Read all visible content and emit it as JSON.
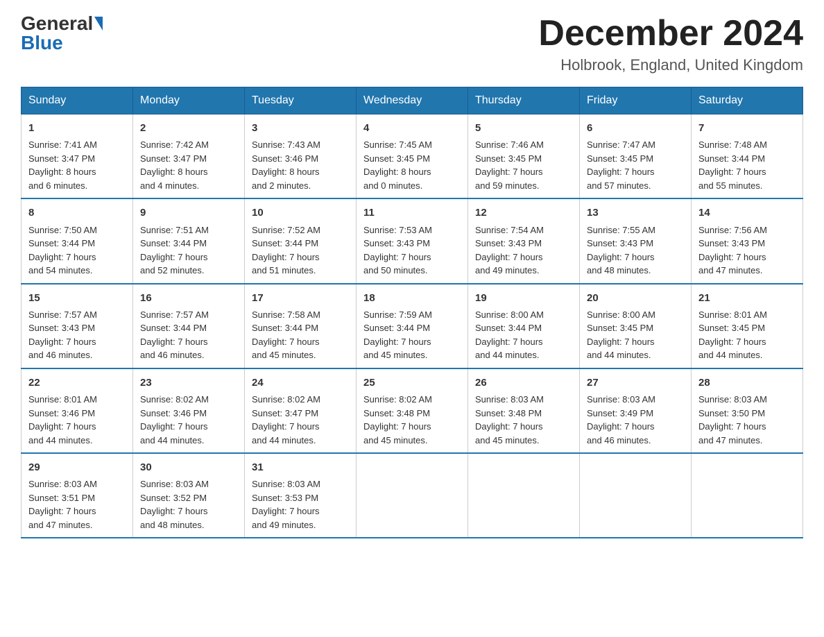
{
  "header": {
    "logo_general": "General",
    "logo_blue": "Blue",
    "month_title": "December 2024",
    "location": "Holbrook, England, United Kingdom"
  },
  "days_of_week": [
    "Sunday",
    "Monday",
    "Tuesday",
    "Wednesday",
    "Thursday",
    "Friday",
    "Saturday"
  ],
  "weeks": [
    [
      {
        "day": "1",
        "sunrise": "7:41 AM",
        "sunset": "3:47 PM",
        "daylight": "8 hours and 6 minutes."
      },
      {
        "day": "2",
        "sunrise": "7:42 AM",
        "sunset": "3:47 PM",
        "daylight": "8 hours and 4 minutes."
      },
      {
        "day": "3",
        "sunrise": "7:43 AM",
        "sunset": "3:46 PM",
        "daylight": "8 hours and 2 minutes."
      },
      {
        "day": "4",
        "sunrise": "7:45 AM",
        "sunset": "3:45 PM",
        "daylight": "8 hours and 0 minutes."
      },
      {
        "day": "5",
        "sunrise": "7:46 AM",
        "sunset": "3:45 PM",
        "daylight": "7 hours and 59 minutes."
      },
      {
        "day": "6",
        "sunrise": "7:47 AM",
        "sunset": "3:45 PM",
        "daylight": "7 hours and 57 minutes."
      },
      {
        "day": "7",
        "sunrise": "7:48 AM",
        "sunset": "3:44 PM",
        "daylight": "7 hours and 55 minutes."
      }
    ],
    [
      {
        "day": "8",
        "sunrise": "7:50 AM",
        "sunset": "3:44 PM",
        "daylight": "7 hours and 54 minutes."
      },
      {
        "day": "9",
        "sunrise": "7:51 AM",
        "sunset": "3:44 PM",
        "daylight": "7 hours and 52 minutes."
      },
      {
        "day": "10",
        "sunrise": "7:52 AM",
        "sunset": "3:44 PM",
        "daylight": "7 hours and 51 minutes."
      },
      {
        "day": "11",
        "sunrise": "7:53 AM",
        "sunset": "3:43 PM",
        "daylight": "7 hours and 50 minutes."
      },
      {
        "day": "12",
        "sunrise": "7:54 AM",
        "sunset": "3:43 PM",
        "daylight": "7 hours and 49 minutes."
      },
      {
        "day": "13",
        "sunrise": "7:55 AM",
        "sunset": "3:43 PM",
        "daylight": "7 hours and 48 minutes."
      },
      {
        "day": "14",
        "sunrise": "7:56 AM",
        "sunset": "3:43 PM",
        "daylight": "7 hours and 47 minutes."
      }
    ],
    [
      {
        "day": "15",
        "sunrise": "7:57 AM",
        "sunset": "3:43 PM",
        "daylight": "7 hours and 46 minutes."
      },
      {
        "day": "16",
        "sunrise": "7:57 AM",
        "sunset": "3:44 PM",
        "daylight": "7 hours and 46 minutes."
      },
      {
        "day": "17",
        "sunrise": "7:58 AM",
        "sunset": "3:44 PM",
        "daylight": "7 hours and 45 minutes."
      },
      {
        "day": "18",
        "sunrise": "7:59 AM",
        "sunset": "3:44 PM",
        "daylight": "7 hours and 45 minutes."
      },
      {
        "day": "19",
        "sunrise": "8:00 AM",
        "sunset": "3:44 PM",
        "daylight": "7 hours and 44 minutes."
      },
      {
        "day": "20",
        "sunrise": "8:00 AM",
        "sunset": "3:45 PM",
        "daylight": "7 hours and 44 minutes."
      },
      {
        "day": "21",
        "sunrise": "8:01 AM",
        "sunset": "3:45 PM",
        "daylight": "7 hours and 44 minutes."
      }
    ],
    [
      {
        "day": "22",
        "sunrise": "8:01 AM",
        "sunset": "3:46 PM",
        "daylight": "7 hours and 44 minutes."
      },
      {
        "day": "23",
        "sunrise": "8:02 AM",
        "sunset": "3:46 PM",
        "daylight": "7 hours and 44 minutes."
      },
      {
        "day": "24",
        "sunrise": "8:02 AM",
        "sunset": "3:47 PM",
        "daylight": "7 hours and 44 minutes."
      },
      {
        "day": "25",
        "sunrise": "8:02 AM",
        "sunset": "3:48 PM",
        "daylight": "7 hours and 45 minutes."
      },
      {
        "day": "26",
        "sunrise": "8:03 AM",
        "sunset": "3:48 PM",
        "daylight": "7 hours and 45 minutes."
      },
      {
        "day": "27",
        "sunrise": "8:03 AM",
        "sunset": "3:49 PM",
        "daylight": "7 hours and 46 minutes."
      },
      {
        "day": "28",
        "sunrise": "8:03 AM",
        "sunset": "3:50 PM",
        "daylight": "7 hours and 47 minutes."
      }
    ],
    [
      {
        "day": "29",
        "sunrise": "8:03 AM",
        "sunset": "3:51 PM",
        "daylight": "7 hours and 47 minutes."
      },
      {
        "day": "30",
        "sunrise": "8:03 AM",
        "sunset": "3:52 PM",
        "daylight": "7 hours and 48 minutes."
      },
      {
        "day": "31",
        "sunrise": "8:03 AM",
        "sunset": "3:53 PM",
        "daylight": "7 hours and 49 minutes."
      },
      null,
      null,
      null,
      null
    ]
  ],
  "labels": {
    "sunrise": "Sunrise: ",
    "sunset": "Sunset: ",
    "daylight": "Daylight: "
  }
}
